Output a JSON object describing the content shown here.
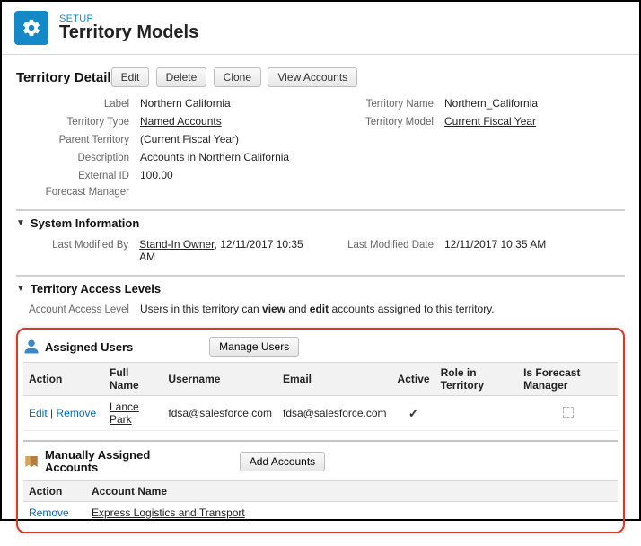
{
  "header": {
    "setup_label": "SETUP",
    "page_title": "Territory Models"
  },
  "detail": {
    "title": "Territory Detail",
    "buttons": {
      "edit": "Edit",
      "del": "Delete",
      "clone": "Clone",
      "view_accounts": "View Accounts"
    },
    "labels": {
      "label": "Label",
      "territory_type": "Territory Type",
      "parent_territory": "Parent Territory",
      "description": "Description",
      "external_id": "External ID",
      "forecast_manager": "Forecast Manager",
      "territory_name": "Territory Name",
      "territory_model": "Territory Model"
    },
    "values": {
      "label": "Northern California",
      "territory_type": "Named Accounts",
      "parent_territory": "(Current Fiscal Year)",
      "description": "Accounts in Northern California",
      "external_id": "100.00",
      "forecast_manager": "",
      "territory_name": "Northern_California",
      "territory_model": "Current Fiscal Year"
    }
  },
  "sysinfo": {
    "title": "System Information",
    "labels": {
      "last_modified_by": "Last Modified By",
      "last_modified_date": "Last Modified Date"
    },
    "values": {
      "modified_by_user": "Stand-In Owner",
      "modified_by_datetime": ", 12/11/2017 10:35 AM",
      "modified_date": "12/11/2017 10:35 AM"
    }
  },
  "access": {
    "title": "Territory Access Levels",
    "label": "Account Access Level",
    "text_1": "Users in this territory can ",
    "bold1": "view",
    "text_2": " and ",
    "bold2": "edit",
    "text_3": " accounts assigned to this territory."
  },
  "assigned_users": {
    "title": "Assigned Users",
    "manage_btn": "Manage Users",
    "cols": {
      "action": "Action",
      "full_name": "Full Name",
      "username": "Username",
      "email": "Email",
      "active": "Active",
      "role": "Role in Territory",
      "forecast_mgr": "Is Forecast Manager"
    },
    "rows": [
      {
        "edit": "Edit",
        "remove": "Remove",
        "full_name": "Lance Park",
        "username": "fdsa@salesforce.com",
        "email": "fdsa@salesforce.com",
        "active": "✓",
        "role": "",
        "is_fm": ""
      }
    ]
  },
  "manual_accounts": {
    "title": "Manually Assigned Accounts",
    "add_btn": "Add Accounts",
    "cols": {
      "action": "Action",
      "account_name": "Account Name"
    },
    "rows": [
      {
        "remove": "Remove",
        "account_name": "Express Logistics and Transport"
      }
    ]
  }
}
